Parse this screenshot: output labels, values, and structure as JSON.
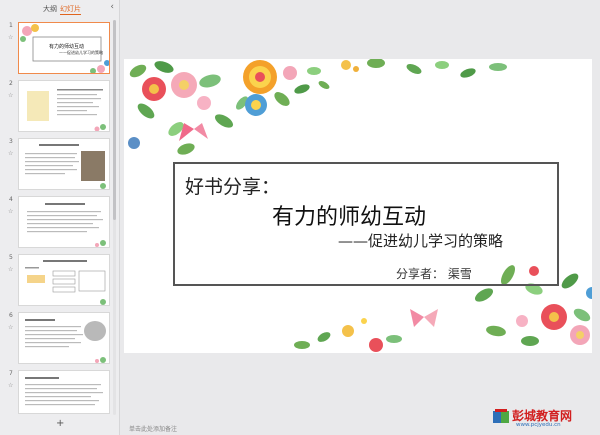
{
  "panel": {
    "tab_outline": "大纲",
    "tab_slides": "幻灯片",
    "collapse_icon": "chevron-left-icon",
    "add_slide_icon": "plus-icon",
    "thumbnails": [
      {
        "number": "1",
        "title": "有力的师幼互动",
        "subtitle": "——促进幼儿学习的策略"
      },
      {
        "number": "2"
      },
      {
        "number": "3"
      },
      {
        "number": "4"
      },
      {
        "number": "5"
      },
      {
        "number": "6"
      },
      {
        "number": "7"
      }
    ]
  },
  "slide": {
    "line1": "好书分享：",
    "line2": "有力的师幼互动",
    "line3": "——促进幼儿学习的策略",
    "line4": "分享者：  渠雪"
  },
  "notes_placeholder": "单击此处添加备注",
  "watermark": {
    "name": "彭城教育网",
    "url": "www.pcjyedu.cn"
  },
  "colors": {
    "accent": "#e0641e",
    "watermark_red": "#d21f1f",
    "watermark_blue": "#2d6fb8"
  }
}
